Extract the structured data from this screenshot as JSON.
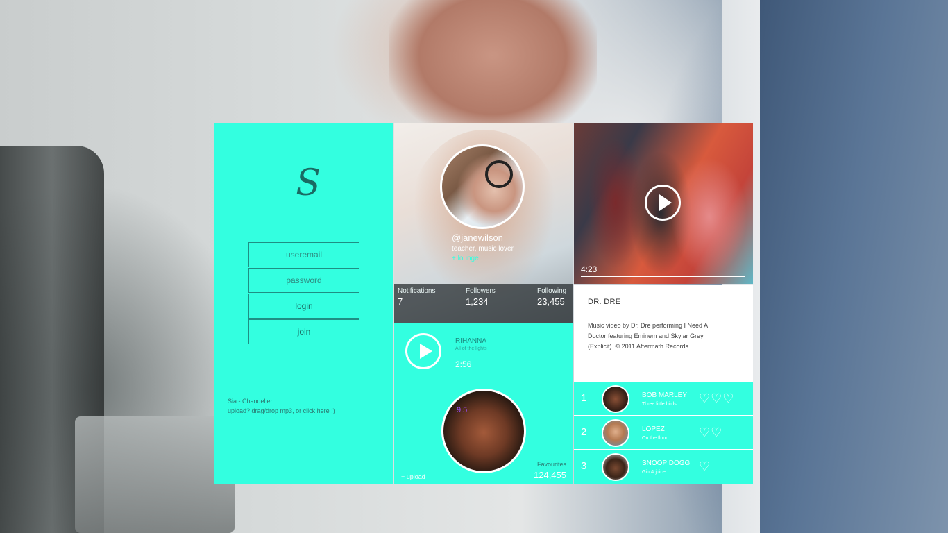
{
  "login": {
    "logo": "S",
    "email_placeholder": "useremail",
    "password_placeholder": "password",
    "login_label": "login",
    "join_label": "join"
  },
  "upload_tile": {
    "track": "Sia - Chandelier",
    "hint": "upload? drag/drop mp3, or click here ;)"
  },
  "profile": {
    "username": "@janewilson",
    "bio": "teacher, music lover",
    "lounge": "+ lounge",
    "stats": [
      {
        "label": "Notifications",
        "value": "7"
      },
      {
        "label": "Followers",
        "value": "1,234"
      },
      {
        "label": "Following",
        "value": "23,455"
      }
    ]
  },
  "player": {
    "artist": "RIHANNA",
    "song": "All of the lights",
    "time": "2:56"
  },
  "favourites": {
    "score": "9.5",
    "upload": "+ upload",
    "label": "Favourites",
    "value": "124,455"
  },
  "video": {
    "time": "4:23",
    "title": "DR. DRE",
    "description": "Music video by Dr. Dre performing I Need A Doctor featuring Eminem and Skylar Grey (Explicit). © 2011 Aftermath Records"
  },
  "chart": [
    {
      "rank": "1",
      "artist": "BOB MARLEY",
      "song": "Three little birds",
      "hearts": "♡♡♡"
    },
    {
      "rank": "2",
      "artist": "LOPEZ",
      "song": "On the floor",
      "hearts": "♡♡"
    },
    {
      "rank": "3",
      "artist": "SNOOP DOGG",
      "song": "Gin & juice",
      "hearts": "♡"
    }
  ],
  "colors": {
    "accent": "#33ffe0",
    "white": "#ffffff"
  }
}
